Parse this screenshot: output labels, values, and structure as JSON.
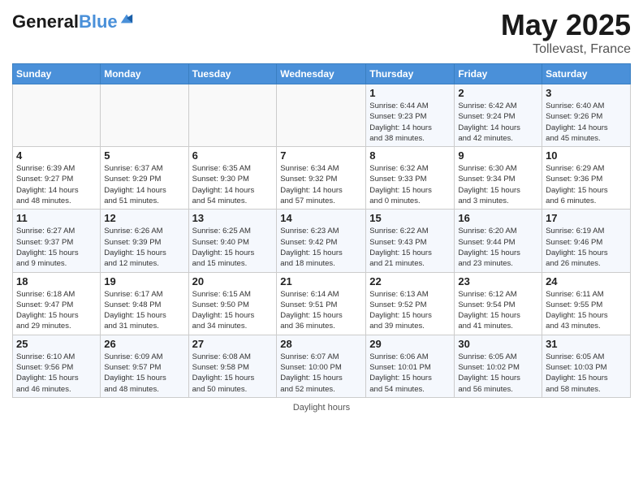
{
  "header": {
    "logo_line1": "General",
    "logo_line2": "Blue",
    "month": "May 2025",
    "location": "Tollevast, France"
  },
  "days_of_week": [
    "Sunday",
    "Monday",
    "Tuesday",
    "Wednesday",
    "Thursday",
    "Friday",
    "Saturday"
  ],
  "weeks": [
    [
      {
        "day": "",
        "info": ""
      },
      {
        "day": "",
        "info": ""
      },
      {
        "day": "",
        "info": ""
      },
      {
        "day": "",
        "info": ""
      },
      {
        "day": "1",
        "info": "Sunrise: 6:44 AM\nSunset: 9:23 PM\nDaylight: 14 hours\nand 38 minutes."
      },
      {
        "day": "2",
        "info": "Sunrise: 6:42 AM\nSunset: 9:24 PM\nDaylight: 14 hours\nand 42 minutes."
      },
      {
        "day": "3",
        "info": "Sunrise: 6:40 AM\nSunset: 9:26 PM\nDaylight: 14 hours\nand 45 minutes."
      }
    ],
    [
      {
        "day": "4",
        "info": "Sunrise: 6:39 AM\nSunset: 9:27 PM\nDaylight: 14 hours\nand 48 minutes."
      },
      {
        "day": "5",
        "info": "Sunrise: 6:37 AM\nSunset: 9:29 PM\nDaylight: 14 hours\nand 51 minutes."
      },
      {
        "day": "6",
        "info": "Sunrise: 6:35 AM\nSunset: 9:30 PM\nDaylight: 14 hours\nand 54 minutes."
      },
      {
        "day": "7",
        "info": "Sunrise: 6:34 AM\nSunset: 9:32 PM\nDaylight: 14 hours\nand 57 minutes."
      },
      {
        "day": "8",
        "info": "Sunrise: 6:32 AM\nSunset: 9:33 PM\nDaylight: 15 hours\nand 0 minutes."
      },
      {
        "day": "9",
        "info": "Sunrise: 6:30 AM\nSunset: 9:34 PM\nDaylight: 15 hours\nand 3 minutes."
      },
      {
        "day": "10",
        "info": "Sunrise: 6:29 AM\nSunset: 9:36 PM\nDaylight: 15 hours\nand 6 minutes."
      }
    ],
    [
      {
        "day": "11",
        "info": "Sunrise: 6:27 AM\nSunset: 9:37 PM\nDaylight: 15 hours\nand 9 minutes."
      },
      {
        "day": "12",
        "info": "Sunrise: 6:26 AM\nSunset: 9:39 PM\nDaylight: 15 hours\nand 12 minutes."
      },
      {
        "day": "13",
        "info": "Sunrise: 6:25 AM\nSunset: 9:40 PM\nDaylight: 15 hours\nand 15 minutes."
      },
      {
        "day": "14",
        "info": "Sunrise: 6:23 AM\nSunset: 9:42 PM\nDaylight: 15 hours\nand 18 minutes."
      },
      {
        "day": "15",
        "info": "Sunrise: 6:22 AM\nSunset: 9:43 PM\nDaylight: 15 hours\nand 21 minutes."
      },
      {
        "day": "16",
        "info": "Sunrise: 6:20 AM\nSunset: 9:44 PM\nDaylight: 15 hours\nand 23 minutes."
      },
      {
        "day": "17",
        "info": "Sunrise: 6:19 AM\nSunset: 9:46 PM\nDaylight: 15 hours\nand 26 minutes."
      }
    ],
    [
      {
        "day": "18",
        "info": "Sunrise: 6:18 AM\nSunset: 9:47 PM\nDaylight: 15 hours\nand 29 minutes."
      },
      {
        "day": "19",
        "info": "Sunrise: 6:17 AM\nSunset: 9:48 PM\nDaylight: 15 hours\nand 31 minutes."
      },
      {
        "day": "20",
        "info": "Sunrise: 6:15 AM\nSunset: 9:50 PM\nDaylight: 15 hours\nand 34 minutes."
      },
      {
        "day": "21",
        "info": "Sunrise: 6:14 AM\nSunset: 9:51 PM\nDaylight: 15 hours\nand 36 minutes."
      },
      {
        "day": "22",
        "info": "Sunrise: 6:13 AM\nSunset: 9:52 PM\nDaylight: 15 hours\nand 39 minutes."
      },
      {
        "day": "23",
        "info": "Sunrise: 6:12 AM\nSunset: 9:54 PM\nDaylight: 15 hours\nand 41 minutes."
      },
      {
        "day": "24",
        "info": "Sunrise: 6:11 AM\nSunset: 9:55 PM\nDaylight: 15 hours\nand 43 minutes."
      }
    ],
    [
      {
        "day": "25",
        "info": "Sunrise: 6:10 AM\nSunset: 9:56 PM\nDaylight: 15 hours\nand 46 minutes."
      },
      {
        "day": "26",
        "info": "Sunrise: 6:09 AM\nSunset: 9:57 PM\nDaylight: 15 hours\nand 48 minutes."
      },
      {
        "day": "27",
        "info": "Sunrise: 6:08 AM\nSunset: 9:58 PM\nDaylight: 15 hours\nand 50 minutes."
      },
      {
        "day": "28",
        "info": "Sunrise: 6:07 AM\nSunset: 10:00 PM\nDaylight: 15 hours\nand 52 minutes."
      },
      {
        "day": "29",
        "info": "Sunrise: 6:06 AM\nSunset: 10:01 PM\nDaylight: 15 hours\nand 54 minutes."
      },
      {
        "day": "30",
        "info": "Sunrise: 6:05 AM\nSunset: 10:02 PM\nDaylight: 15 hours\nand 56 minutes."
      },
      {
        "day": "31",
        "info": "Sunrise: 6:05 AM\nSunset: 10:03 PM\nDaylight: 15 hours\nand 58 minutes."
      }
    ]
  ],
  "footer": {
    "daylight_label": "Daylight hours"
  }
}
